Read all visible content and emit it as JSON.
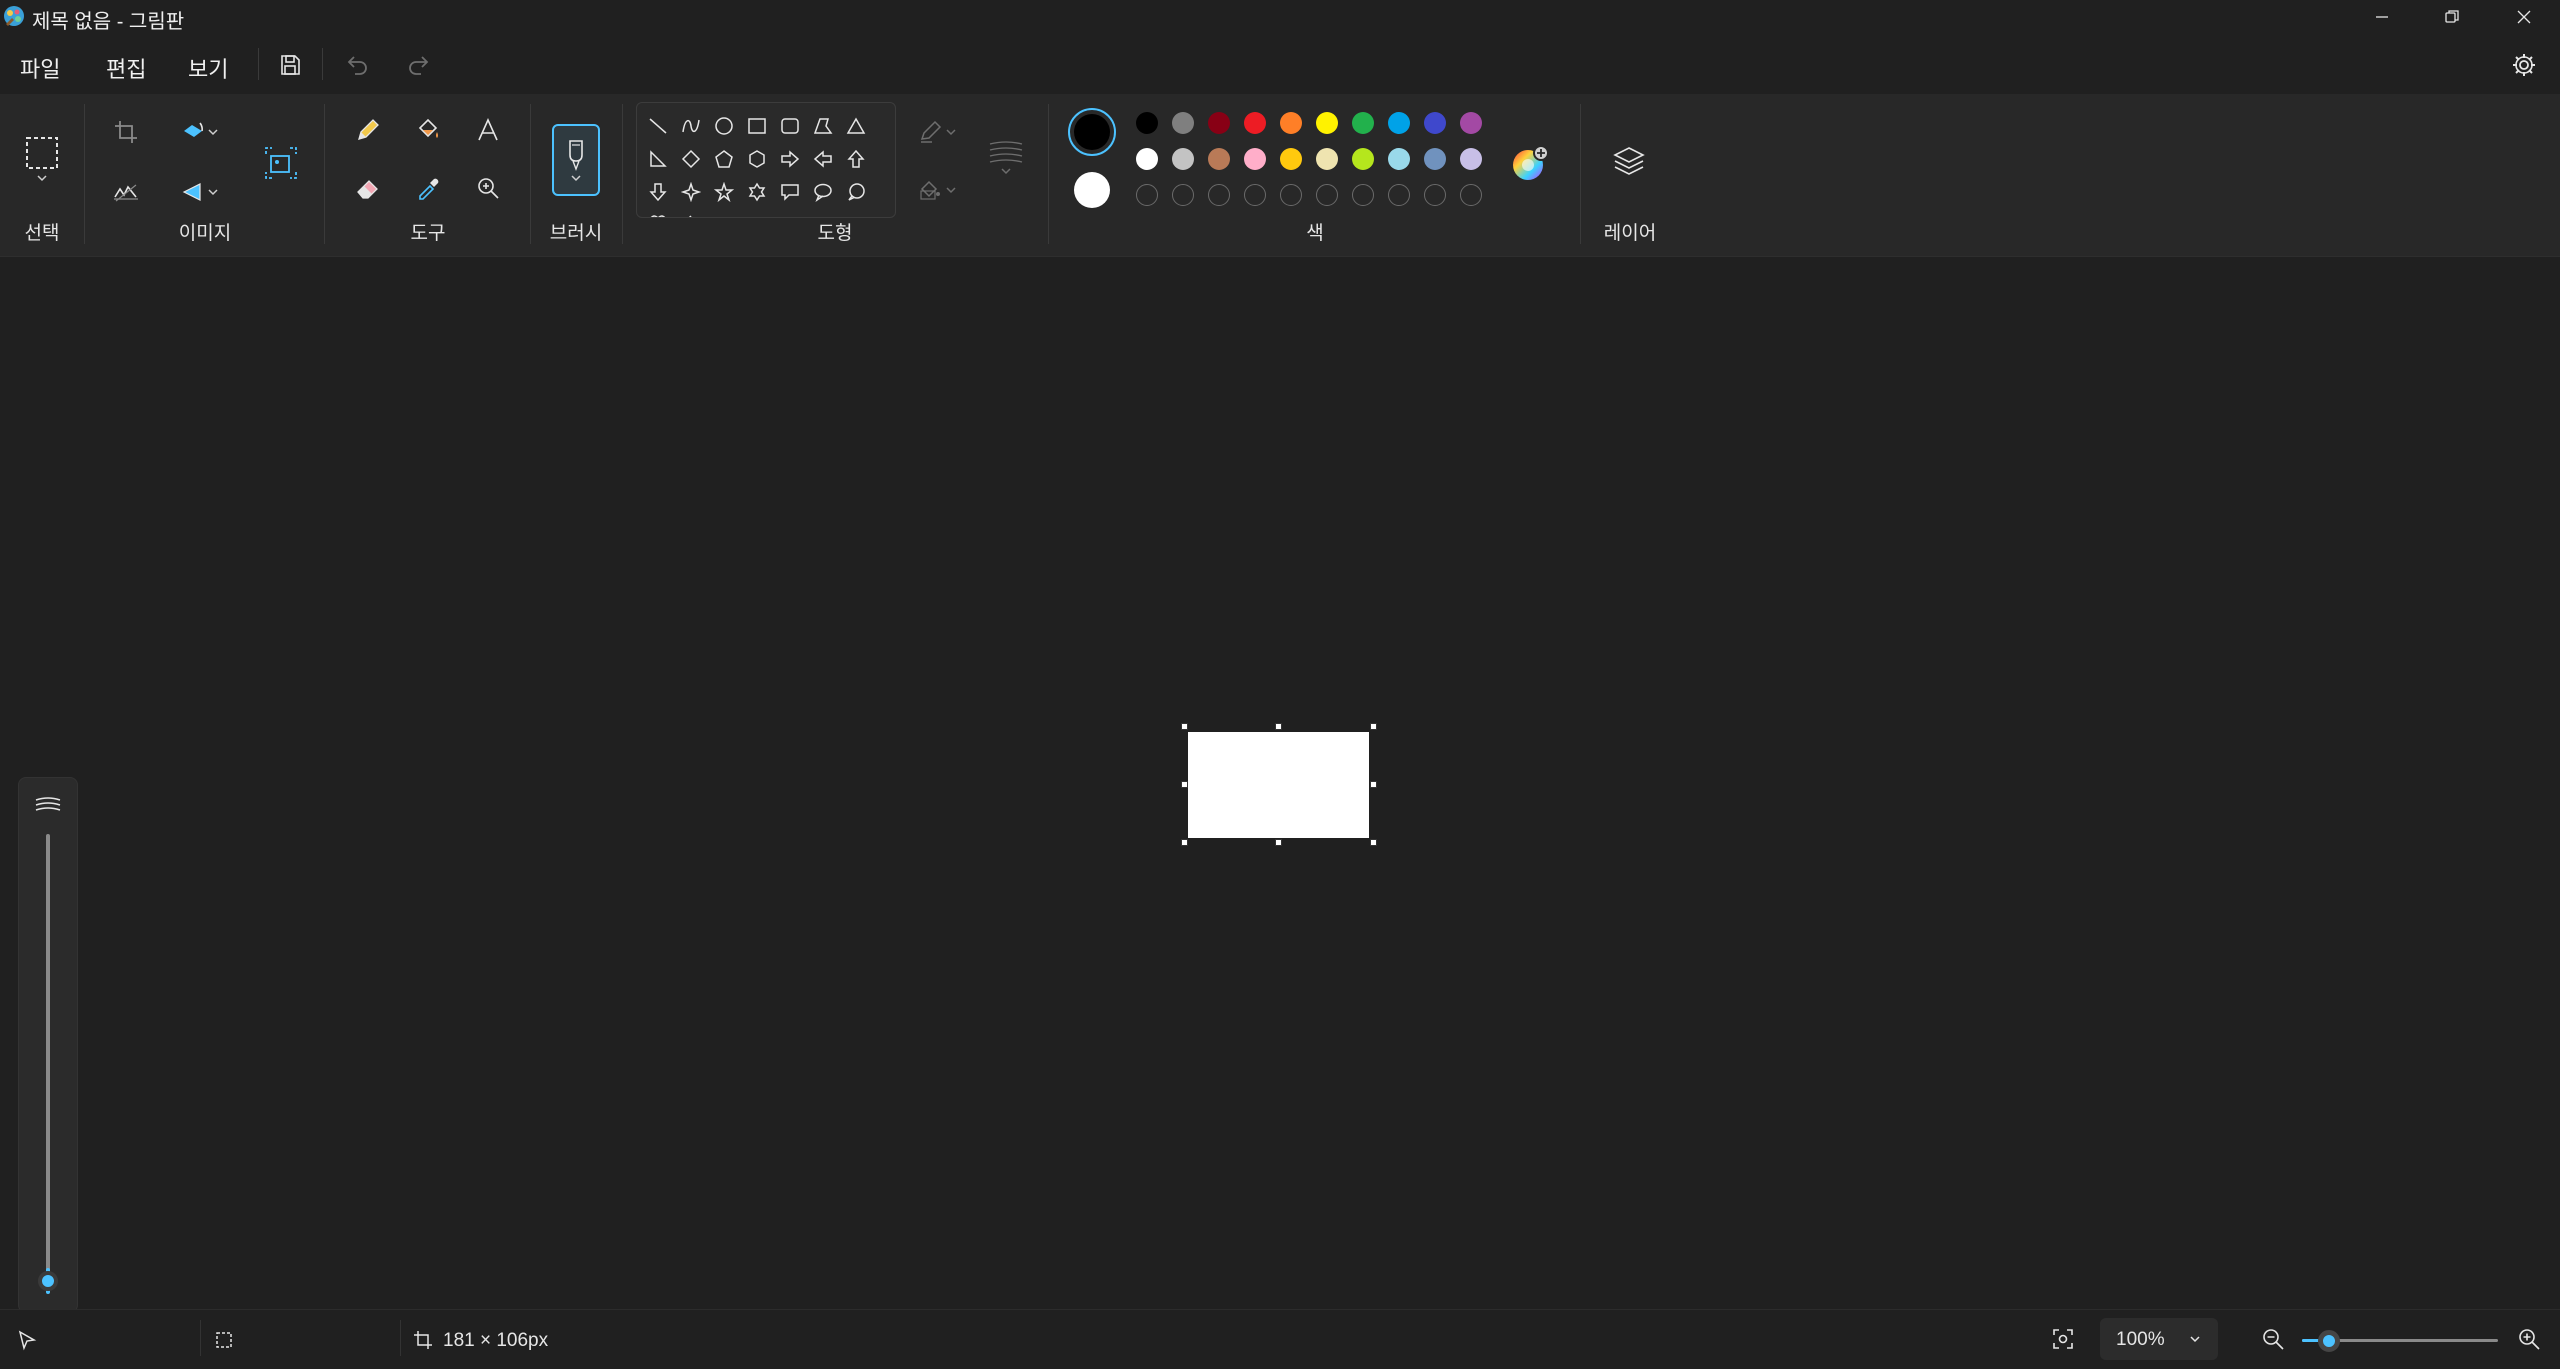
{
  "window": {
    "title": "제목 없음 - 그림판"
  },
  "menu": {
    "file": "파일",
    "edit": "편집",
    "view": "보기"
  },
  "ribbon": {
    "groups": {
      "select": "선택",
      "image": "이미지",
      "tools": "도구",
      "brush": "브러시",
      "shapes": "도형",
      "colors": "색",
      "layers": "레이어"
    }
  },
  "colors": {
    "primary": "#000000",
    "secondary": "#ffffff",
    "accent": "#4cc2ff",
    "palette_row1": [
      "#000000",
      "#7f7f7f",
      "#880015",
      "#ed1c24",
      "#ff7f27",
      "#fff200",
      "#22b14c",
      "#00a2e8",
      "#3f48cc",
      "#a349a4"
    ],
    "palette_row2": [
      "#ffffff",
      "#c3c3c3",
      "#b97a57",
      "#ffaec9",
      "#ffc90e",
      "#efe4b0",
      "#b5e61d",
      "#99d9ea",
      "#7092be",
      "#c8bfe7"
    ]
  },
  "status": {
    "canvas_size": "181 × 106px",
    "zoom": "100%"
  }
}
